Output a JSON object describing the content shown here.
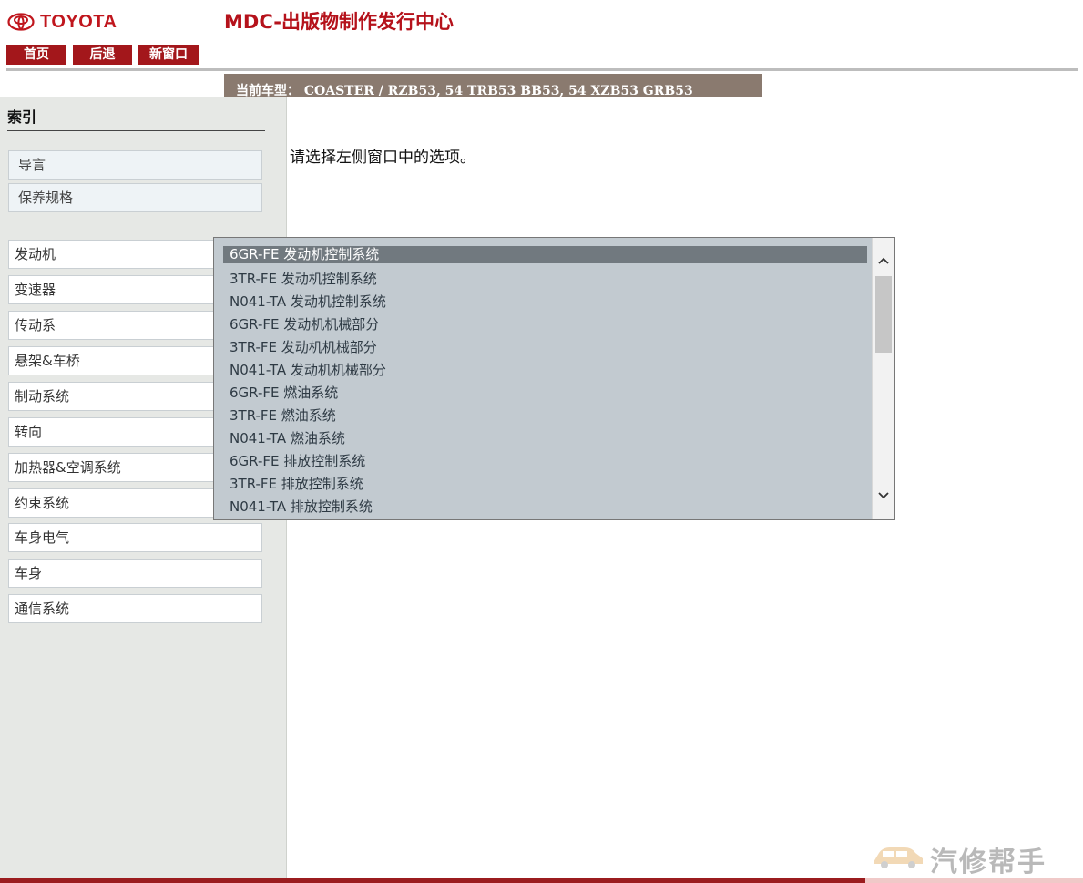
{
  "header": {
    "brand": "TOYOTA",
    "title": "MDC-出版物制作发行中心",
    "nav": {
      "home": "首页",
      "back": "后退",
      "new_window": "新窗口"
    },
    "vehicle": "当前车型： COASTER / RZB53, 54 TRB53 BB53, 54 XZB53 GRB53"
  },
  "sidebar": {
    "heading": "索引",
    "intro_items": [
      "导言",
      "保养规格"
    ],
    "categories": [
      "发动机",
      "变速器",
      "传动系",
      "悬架&车桥",
      "制动系统",
      "转向",
      "加热器&空调系统",
      "约束系统",
      "车身电气",
      "车身",
      "通信系统"
    ]
  },
  "main": {
    "prompt": "请选择左侧窗口中的选项。"
  },
  "dropdown": {
    "selected_index": 0,
    "items": [
      "6GR-FE 发动机控制系统",
      "3TR-FE 发动机控制系统",
      "N041-TA 发动机控制系统",
      "6GR-FE 发动机机械部分",
      "3TR-FE 发动机机械部分",
      "N041-TA 发动机机械部分",
      "6GR-FE 燃油系统",
      "3TR-FE 燃油系统",
      "N041-TA 燃油系统",
      "6GR-FE 排放控制系统",
      "3TR-FE 排放控制系统",
      "N041-TA 排放控制系统"
    ]
  },
  "footer": {
    "watermark": "汽修帮手"
  },
  "colors": {
    "brand_red": "#c0161d",
    "nav_button": "#a3171b",
    "vehicle_bar": "#8a7a6f",
    "sidebar_bg": "#e6e8e5",
    "dropdown_bg": "#c2cad0",
    "dropdown_selected": "#71797f"
  },
  "icons": {
    "logo": "toyota-emblem-icon",
    "scroll_up": "chevron-up-icon",
    "scroll_down": "chevron-down-icon",
    "watermark": "car-icon"
  }
}
